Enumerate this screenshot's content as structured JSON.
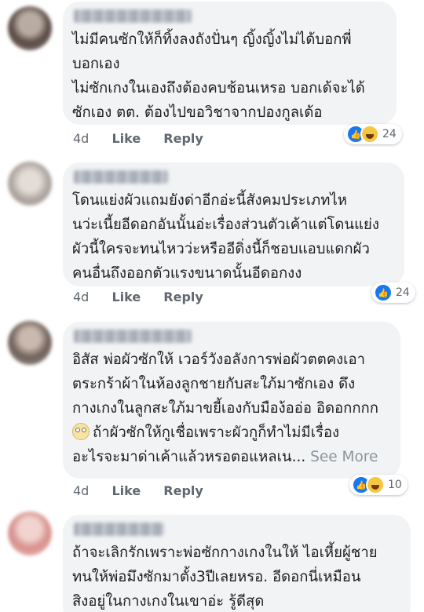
{
  "comments": [
    {
      "lines": [
        "ไม่มีคนซักให้ก็ทิ้งลงถังปั่นๆ ญิ้งญิ้งไม่ได้บอกพี่",
        "บอกเอง",
        "ไม่ซักเกงในเองถึงต้องคบช้อนเหรอ บอกเด้จะได้",
        "ซักเอง ตต. ต้องไปขอวิชาจากปองกูลเด้อ"
      ],
      "time": "4d",
      "like": "Like",
      "reply": "Reply",
      "reaction_icons": [
        "like-icon",
        "haha-icon"
      ],
      "reaction_count": "24"
    },
    {
      "lines": [
        "โดนแย่งผัวแถมยังด่าอีกอ่ะนี้สังคมประเภทไห",
        "นว่ะเนี้ยอีดอกอันนั้นอ่ะเรื่องส่วนตัวเค้าแต่โดนแย่ง",
        "ผัวนี้ใครจะทนไหวว่ะหรืออีดิ่งนี้ก็ชอบแอบแดกผัว",
        "คนอื่นถึงออกตัวแรงขนาดนั้นอีดอกงง"
      ],
      "time": "4d",
      "like": "Like",
      "reply": "Reply",
      "reaction_icons": [
        "like-icon"
      ],
      "reaction_count": "24"
    },
    {
      "lines": [
        "อิสัส พ่อผัวซักให้ เวอร์วังอลังการพ่อผัวตตคงเอา",
        "ตระกร้าผ้าในห้องลูกชายกับสะใภ้มาซักเอง ดึง",
        "กางเกงในลูกสะใภ้มาขยี้เองกับมือง้ออ่อ อิดอกกกก",
        "ถ้าผัวซักให้กูเชื่อเพราะผัวกูก็ทำไม่มีเรื่อง",
        "อะไรจะมาด่าเค้าแล้วหรอตอแหลเน..."
      ],
      "see_more": "See More",
      "time": "4d",
      "like": "Like",
      "reply": "Reply",
      "reaction_icons": [
        "like-icon",
        "haha-icon"
      ],
      "reaction_count": "10"
    },
    {
      "lines": [
        "ถ้าจะเลิกรักเพราะพ่อซักกางเกงในให้ ไอเหี้ยผู้ชาย",
        "ทนให้พ่อมึงซักมาตั้ง3ปีเลยหรอ. อีดอกนี่เหมือน",
        "สิงอยู่ในกางเกงในเขาอ่ะ รู้ดีสุด"
      ]
    }
  ],
  "colors": {
    "bubble": "#f2f3f5",
    "like_blue": "#1877f2",
    "meta_text": "#606770"
  }
}
